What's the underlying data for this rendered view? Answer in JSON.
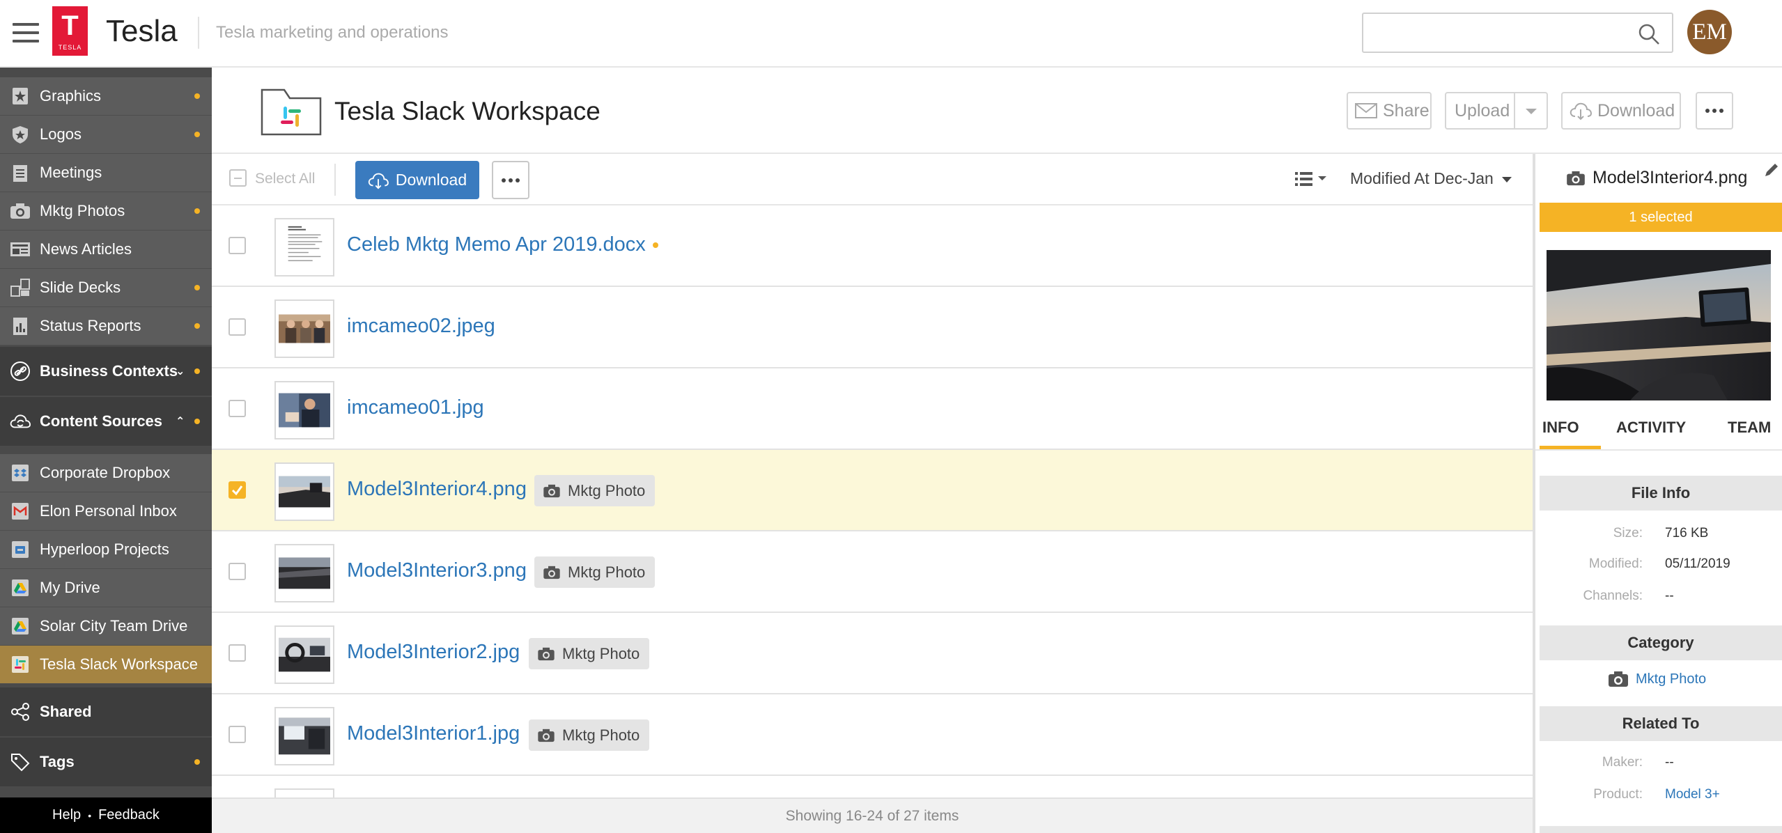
{
  "app": {
    "title": "Tesla",
    "logo_text": "TESLA",
    "subtitle": "Tesla marketing and operations",
    "search_placeholder": "",
    "avatar_initials": "EM",
    "brand_color": "#e31937"
  },
  "sidebar": {
    "items": [
      {
        "label": "Graphics",
        "icon": "star-badge-icon",
        "dot": true
      },
      {
        "label": "Logos",
        "icon": "shield-star-icon",
        "dot": true
      },
      {
        "label": "Meetings",
        "icon": "notepad-icon",
        "dot": false
      },
      {
        "label": "Mktg Photos",
        "icon": "camera-icon",
        "dot": true
      },
      {
        "label": "News Articles",
        "icon": "newspaper-icon",
        "dot": false
      },
      {
        "label": "Slide Decks",
        "icon": "slides-icon",
        "dot": true
      },
      {
        "label": "Status Reports",
        "icon": "report-icon",
        "dot": true
      }
    ],
    "business_contexts": "Business Contexts",
    "content_sources": "Content Sources",
    "sources": [
      {
        "label": "Corporate Dropbox",
        "icon": "dropbox-icon"
      },
      {
        "label": "Elon Personal Inbox",
        "icon": "gmail-icon"
      },
      {
        "label": "Hyperloop Projects",
        "icon": "drive-folder-icon"
      },
      {
        "label": "My Drive",
        "icon": "google-drive-icon"
      },
      {
        "label": "Solar City Team Drive",
        "icon": "google-drive-icon"
      },
      {
        "label": "Tesla Slack Workspace",
        "icon": "slack-icon",
        "active": true
      }
    ],
    "shared": "Shared",
    "tags": "Tags",
    "help": "Help",
    "feedback": "Feedback",
    "separator": "•"
  },
  "folder": {
    "title": "Tesla Slack Workspace",
    "share": "Share",
    "upload": "Upload",
    "download": "Download"
  },
  "toolbar": {
    "select_all": "Select All",
    "download": "Download",
    "sort": "Modified At Dec-Jan"
  },
  "files": [
    {
      "name": "Celeb Mktg Memo Apr 2019.docx",
      "modified_dot": true,
      "tag": "",
      "checked": false,
      "thumb": "document"
    },
    {
      "name": "imcameo02.jpeg",
      "tag": "",
      "checked": false,
      "thumb": "people-photo"
    },
    {
      "name": "imcameo01.jpg",
      "tag": "",
      "checked": false,
      "thumb": "people-photo-2"
    },
    {
      "name": "Model3Interior4.png",
      "tag": "Mktg Photo",
      "checked": true,
      "thumb": "interior-dash"
    },
    {
      "name": "Model3Interior3.png",
      "tag": "Mktg Photo",
      "checked": false,
      "thumb": "interior-dark"
    },
    {
      "name": "Model3Interior2.jpg",
      "tag": "Mktg Photo",
      "checked": false,
      "thumb": "interior-wheel"
    },
    {
      "name": "Model3Interior1.jpg",
      "tag": "Mktg Photo",
      "checked": false,
      "thumb": "interior-screen"
    }
  ],
  "status": "Showing 16-24 of 27 items",
  "panel": {
    "file_name": "Model3Interior4.png",
    "selected_banner": "1 selected",
    "tabs": [
      "INFO",
      "ACTIVITY",
      "TEAM"
    ],
    "file_info_heading": "File Info",
    "size_label": "Size:",
    "size": "716 KB",
    "modified_label": "Modified:",
    "modified": "05/11/2019",
    "channels_label": "Channels:",
    "channels": "--",
    "category_heading": "Category",
    "category": "Mktg Photo",
    "related_heading": "Related To",
    "maker_label": "Maker:",
    "maker": "--",
    "product_label": "Product:",
    "product": "Model 3+"
  },
  "colors": {
    "accent": "#f5b325",
    "link": "#2c76b8",
    "primary_button": "#3a7bbf",
    "sidebar_bg": "#4a4a4a",
    "active_source": "#a58442",
    "selected_row": "#fcf8d9"
  }
}
